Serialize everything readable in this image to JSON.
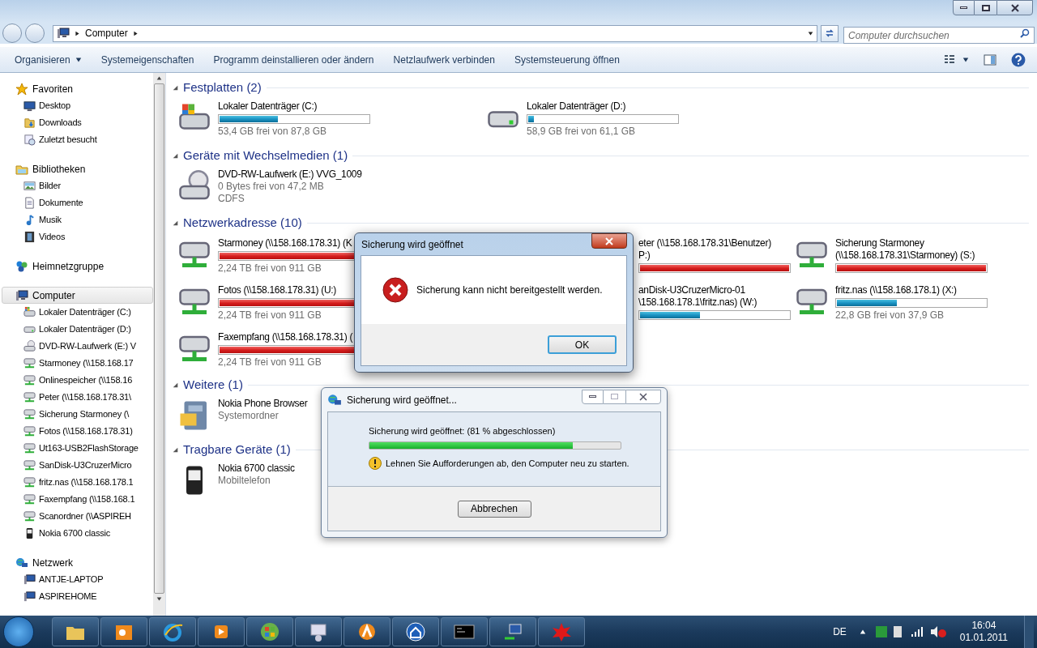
{
  "address": {
    "path": [
      "Computer"
    ],
    "search_placeholder": "Computer durchsuchen"
  },
  "toolbar": [
    {
      "label": "Organisieren",
      "dropdown": true
    },
    {
      "label": "Systemeigenschaften",
      "dropdown": false
    },
    {
      "label": "Programm deinstallieren oder ändern",
      "dropdown": false
    },
    {
      "label": "Netzlaufwerk verbinden",
      "dropdown": false
    },
    {
      "label": "Systemsteuerung öffnen",
      "dropdown": false
    }
  ],
  "sidebar": [
    {
      "label": "Favoriten",
      "kind": "star",
      "selected": false,
      "children": [
        {
          "label": "Desktop",
          "kind": "desktop",
          "selected": false
        },
        {
          "label": "Downloads",
          "kind": "download",
          "selected": false
        },
        {
          "label": "Zuletzt besucht",
          "kind": "recent",
          "selected": false
        }
      ]
    },
    {
      "label": "Bibliotheken",
      "kind": "library",
      "selected": false,
      "children": [
        {
          "label": "Bilder",
          "kind": "pictures",
          "selected": false
        },
        {
          "label": "Dokumente",
          "kind": "document",
          "selected": false
        },
        {
          "label": "Musik",
          "kind": "music",
          "selected": false
        },
        {
          "label": "Videos",
          "kind": "video",
          "selected": false
        }
      ]
    },
    {
      "label": "Heimnetzgruppe",
      "kind": "homegroup",
      "selected": false
    },
    {
      "label": "Computer",
      "kind": "computer",
      "selected": true,
      "children": [
        {
          "label": "Lokaler Datenträger (C:)",
          "kind": "windrive",
          "selected": false
        },
        {
          "label": "Lokaler Datenträger (D:)",
          "kind": "drive",
          "selected": false
        },
        {
          "label": "DVD-RW-Laufwerk (E:) V",
          "kind": "dvd",
          "selected": false
        },
        {
          "label": "Starmoney (\\\\158.168.17",
          "kind": "netdrive",
          "selected": false
        },
        {
          "label": "Onlinespeicher (\\\\158.16",
          "kind": "netdrive",
          "selected": false
        },
        {
          "label": "Peter (\\\\158.168.178.31\\",
          "kind": "netdrive",
          "selected": false
        },
        {
          "label": "Sicherung Starmoney (\\",
          "kind": "netdrive",
          "selected": false
        },
        {
          "label": "Fotos (\\\\158.168.178.31)",
          "kind": "netdrive",
          "selected": false
        },
        {
          "label": "Ut163-USB2FlashStorage",
          "kind": "netdrive",
          "selected": false
        },
        {
          "label": "SanDisk-U3CruzerMicro",
          "kind": "netdrive",
          "selected": false
        },
        {
          "label": "fritz.nas (\\\\158.168.178.1",
          "kind": "netdrive",
          "selected": false
        },
        {
          "label": "Faxempfang (\\\\158.168.1",
          "kind": "netdrive",
          "selected": false
        },
        {
          "label": "Scanordner (\\\\ASPIREH",
          "kind": "netdrive",
          "selected": false
        },
        {
          "label": "Nokia 6700 classic",
          "kind": "phone",
          "selected": false
        }
      ]
    },
    {
      "label": "Netzwerk",
      "kind": "network",
      "selected": false,
      "children": [
        {
          "label": "ANTJE-LAPTOP",
          "kind": "pc",
          "selected": false
        },
        {
          "label": "ASPIREHOME",
          "kind": "pc",
          "selected": false
        }
      ]
    }
  ],
  "sections": [
    {
      "title": "Festplatten (2)",
      "items": [
        {
          "kind": "windrive",
          "lines": [
            "Lokaler Datenträger (C:)"
          ],
          "level": 0.39,
          "critical": false,
          "details": [
            "53,4 GB frei von 87,8 GB"
          ]
        },
        {
          "kind": "drive",
          "lines": [
            "Lokaler Datenträger (D:)"
          ],
          "level": 0.04,
          "critical": false,
          "details": [
            "58,9 GB frei von 61,1 GB"
          ]
        }
      ]
    },
    {
      "title": "Geräte mit Wechselmedien (1)",
      "items": [
        {
          "kind": "dvd",
          "lines": [
            "DVD-RW-Laufwerk (E:) VVG_1009"
          ],
          "details": [
            "0 Bytes frei von 47,2 MB",
            "CDFS"
          ]
        }
      ]
    },
    {
      "title": "Netzwerkadresse (10)",
      "items": [
        {
          "kind": "netdrive",
          "lines": [
            "Starmoney (\\\\158.168.178.31) (K"
          ],
          "level": 1,
          "critical": true,
          "details": [
            "2,24 TB frei von 911 GB"
          ]
        },
        {
          "kind": "covered",
          "lines": [
            "eter (\\\\158.168.178.31\\Benutzer)",
            "P:)"
          ],
          "level": 1,
          "critical": true
        },
        {
          "kind": "netdrive",
          "lines": [
            "Sicherung Starmoney",
            "(\\\\158.168.178.31\\Starmoney) (S:)"
          ],
          "level": 1,
          "critical": true
        },
        {
          "kind": "netdrive",
          "lines": [
            "Fotos (\\\\158.168.178.31) (U:)"
          ],
          "level": 1,
          "critical": true,
          "details": [
            "2,24 TB frei von 911 GB"
          ]
        },
        {
          "kind": "covered",
          "lines": [
            "anDisk-U3CruzerMicro-01",
            "\\158.168.178.1\\fritz.nas) (W:)"
          ],
          "level": 0.4,
          "critical": false
        },
        {
          "kind": "netdrive",
          "lines": [
            "fritz.nas (\\\\158.168.178.1) (X:)"
          ],
          "level": 0.4,
          "critical": false,
          "details": [
            "22,8 GB frei von 37,9 GB"
          ]
        },
        {
          "kind": "netdrive",
          "lines": [
            "Faxempfang (\\\\158.168.178.31) ("
          ],
          "level": 1,
          "critical": true,
          "details": [
            "2,24 TB frei von 911 GB"
          ]
        }
      ]
    },
    {
      "title": "Weitere (1)",
      "items": [
        {
          "kind": "cabinet",
          "lines": [
            "Nokia Phone Browser"
          ],
          "details": [
            "Systemordner"
          ]
        }
      ]
    },
    {
      "title": "Tragbare Geräte (1)",
      "items": [
        {
          "kind": "phone",
          "lines": [
            "Nokia 6700 classic"
          ],
          "details": [
            "Mobiltelefon"
          ]
        }
      ]
    }
  ],
  "error_dialog": {
    "title": "Sicherung wird geöffnet",
    "message": "Sicherung kann nicht bereitgestellt werden.",
    "button": "OK"
  },
  "progress_dialog": {
    "title": "Sicherung wird geöffnet...",
    "status": "Sicherung wird geöffnet: (81 % abgeschlossen)",
    "level": 0.81,
    "warning": "Lehnen Sie Aufforderungen ab, den Computer neu zu starten.",
    "button": "Abbrechen"
  },
  "taskbar": {
    "apps": [
      {
        "kind": "explorer"
      },
      {
        "kind": "outlook"
      },
      {
        "kind": "ie"
      },
      {
        "kind": "media"
      },
      {
        "kind": "windows"
      },
      {
        "kind": "panel"
      },
      {
        "kind": "avast"
      },
      {
        "kind": "home"
      },
      {
        "kind": "cmd"
      },
      {
        "kind": "network"
      },
      {
        "kind": "splat"
      }
    ],
    "language": "DE",
    "time": "16:04",
    "date": "01.01.2011"
  }
}
